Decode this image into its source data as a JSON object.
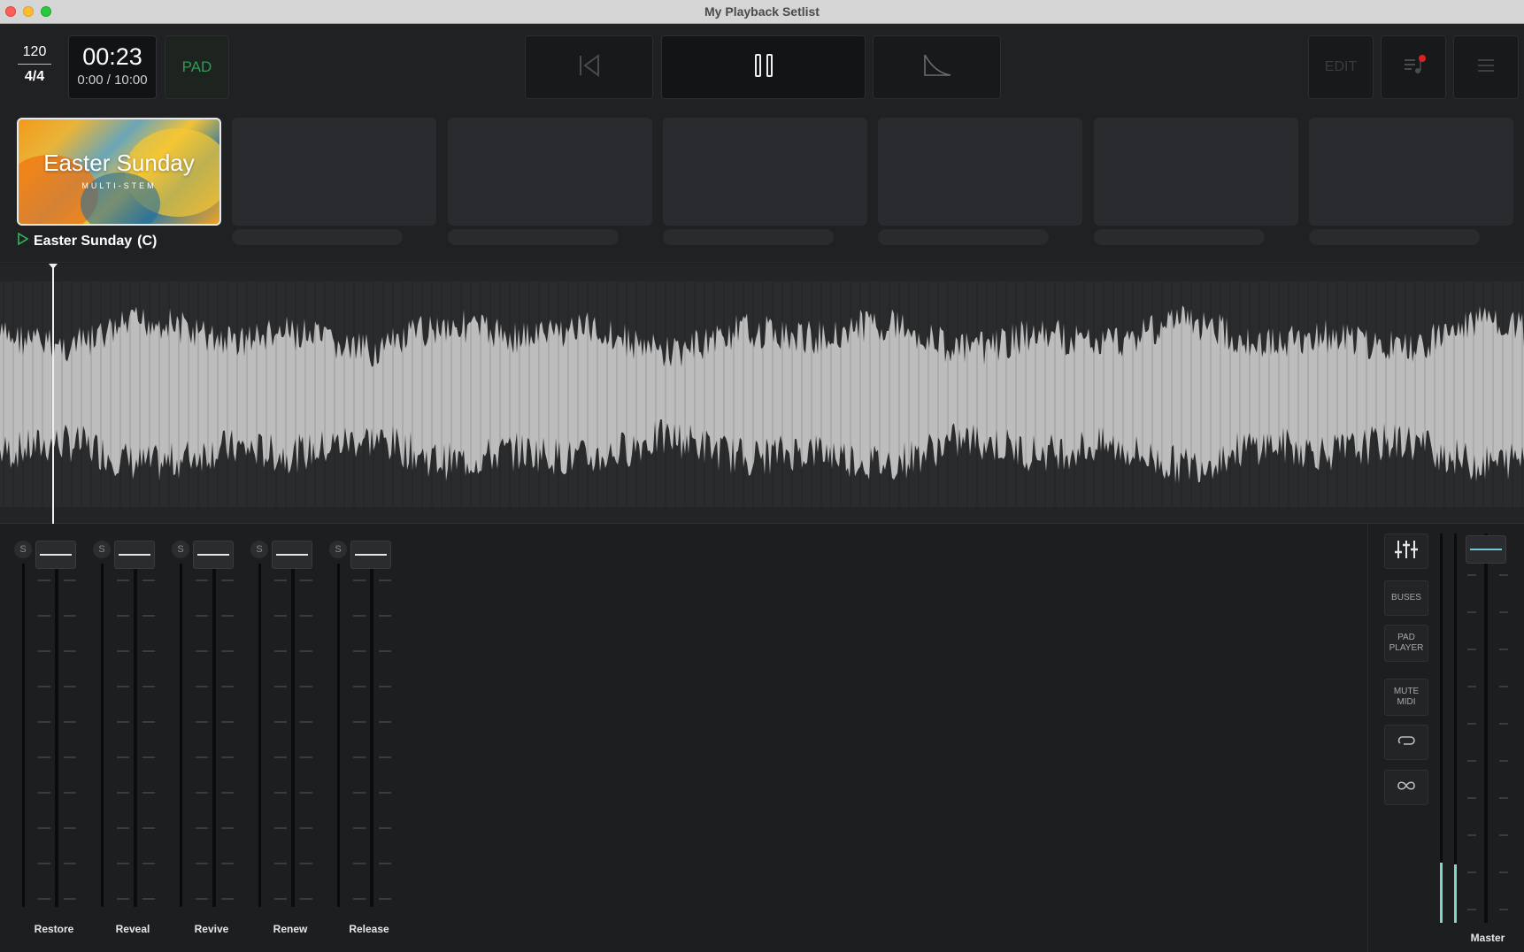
{
  "window": {
    "title": "My Playback Setlist"
  },
  "transport": {
    "bpm": "120",
    "time_signature": "4/4",
    "elapsed": "00:23",
    "position": "0:00 / 10:00",
    "pad_label": "PAD",
    "edit_label": "EDIT"
  },
  "setlist": {
    "current": {
      "art_title": "Easter Sunday",
      "art_subtitle": "MULTI-STEM",
      "name": "Easter Sunday",
      "key": "(C)"
    }
  },
  "mixer": {
    "solo_label": "S",
    "channels": [
      {
        "name": "Restore"
      },
      {
        "name": "Reveal"
      },
      {
        "name": "Revive"
      },
      {
        "name": "Renew"
      },
      {
        "name": "Release"
      }
    ],
    "side_buttons": {
      "buses": "BUSES",
      "pad_player_1": "PAD",
      "pad_player_2": "PLAYER",
      "mute_midi_1": "MUTE",
      "mute_midi_2": "MIDI"
    },
    "master_label": "Master"
  },
  "colors": {
    "accent_green": "#2f9a53",
    "meter_teal": "#7fd6c4",
    "notification_red": "#e02020"
  }
}
